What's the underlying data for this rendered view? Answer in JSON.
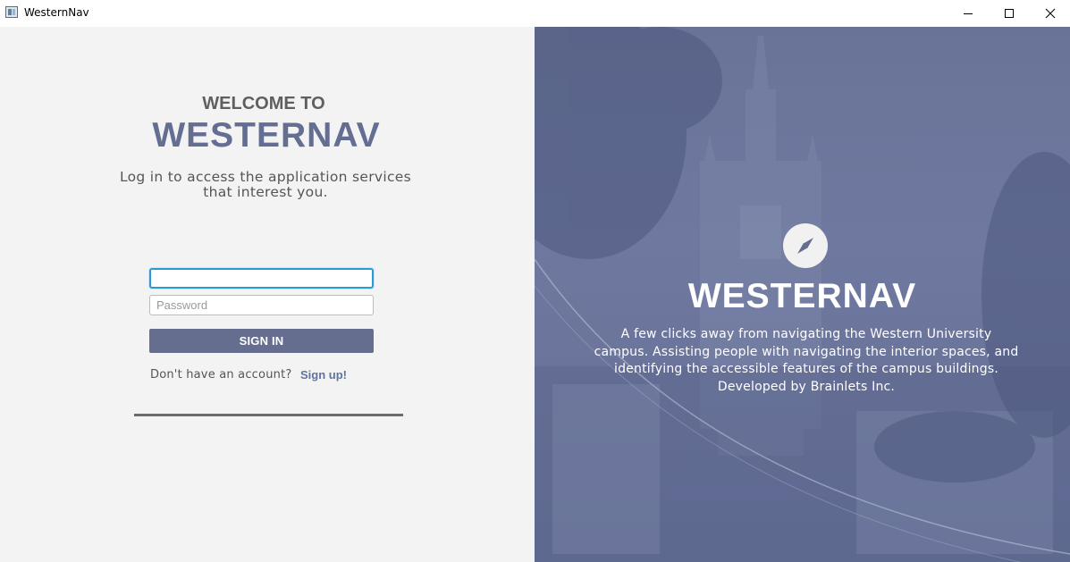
{
  "window": {
    "title": "WesternNav",
    "minimize_icon": "minimize-icon",
    "maximize_icon": "maximize-icon",
    "close_icon": "close-icon"
  },
  "login": {
    "welcome": "WELCOME TO",
    "brand": "WESTERNAV",
    "subtitle_line1": "Log in to access the application services",
    "subtitle_line2": "that interest you.",
    "username_value": "",
    "password_placeholder": "Password",
    "sign_in_label": "SIGN IN",
    "no_account_text": "Don't have an account?",
    "sign_up_label": "Sign up!"
  },
  "info": {
    "logo_icon": "compass-icon",
    "brand": "WESTERNAV",
    "desc_line1": "A few clicks away from navigating the Western University",
    "desc_line2": "campus. Assisting people with navigating the interior spaces, and",
    "desc_line3": "identifying the accessible features of the campus buildings.",
    "desc_line4": "Developed by Brainlets Inc."
  },
  "colors": {
    "accent": "#666e90",
    "brand_text": "#646d92",
    "link": "#5e73a3",
    "focus_border": "#2c9ad6",
    "panel_bg": "#6b749a"
  }
}
